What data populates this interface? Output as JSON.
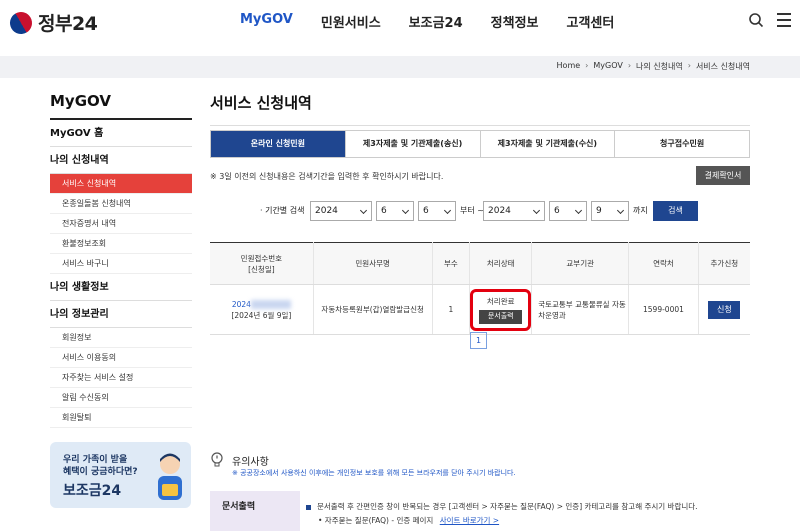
{
  "header": {
    "logo_text": "정부24",
    "nav": [
      "MyGOV",
      "민원서비스",
      "보조금24",
      "정책정보",
      "고객센터"
    ]
  },
  "breadcrumb": [
    "Home",
    "MyGOV",
    "나의 신청내역",
    "서비스 신청내역"
  ],
  "sidebar": {
    "title": "MyGOV",
    "home": "MyGOV 홈",
    "sec_history": "나의 신청내역",
    "history_items": [
      "서비스 신청내역",
      "온종일돌봄 신청내역",
      "전자증명서 내역",
      "환불정보조회",
      "서비스 바구니"
    ],
    "sec_life": "나의 생활정보",
    "sec_info": "나의 정보관리",
    "info_items": [
      "회원정보",
      "서비스 이용동의",
      "자주찾는 서비스 설정",
      "알림 수신동의",
      "회원탈퇴"
    ],
    "banner_line1": "우리 가족이 받을",
    "banner_line2": "혜택이 궁금하다면?",
    "banner_title": "보조금24"
  },
  "main": {
    "title": "서비스 신청내역",
    "tabs": [
      "온라인 신청민원",
      "제3자제출 및 기관제출(송신)",
      "제3자제출 및 기관제출(수신)",
      "청구접수민원"
    ],
    "notice": "※ 3일 이전의 신청내용은 검색기간을 입력한 후 확인하시기 바랍니다.",
    "receipt_btn": "결제확인서",
    "filter": {
      "label": "· 기간별 검색",
      "from_year": "2024",
      "from_month": "6",
      "from_day": "6",
      "middle": "부터 ~",
      "to_year": "2024",
      "to_month": "6",
      "to_day": "9",
      "end": "까지",
      "search_btn": "검색"
    },
    "table": {
      "headers": [
        "민원접수번호\n[신청일]",
        "민원사무명",
        "부수",
        "처리상태",
        "교부기관",
        "연락처",
        "추가신청"
      ],
      "row": {
        "receipt_no": "2024",
        "date": "[2024년 6월 9일]",
        "name": "자동차등록원부(갑)열람발급신청",
        "copies": "1",
        "status": "처리완료",
        "doc_btn": "문서출력",
        "agency": "국토교통부 교통물류실 자동차운영과",
        "contact": "1599-0001",
        "apply_btn": "신청"
      }
    },
    "page": "1",
    "notes_title": "유의사항",
    "notes_desc": "※ 공공장소에서 사용하신 이후에는 개인정보 보호를 위해 모든 브라우저를 닫아 주시기 바랍니다.",
    "docbox": {
      "label": "문서출력",
      "line1": "문서출력 후 간편인증 창이 반복되는 경우 [고객센터 > 자주묻는 질문(FAQ) > 인증] 카테고리를 참고해 주시기 바랍니다.",
      "line2": "• 자주묻는 질문(FAQ) - 인증 페이지",
      "link": "사이트 바로가기 >"
    }
  }
}
